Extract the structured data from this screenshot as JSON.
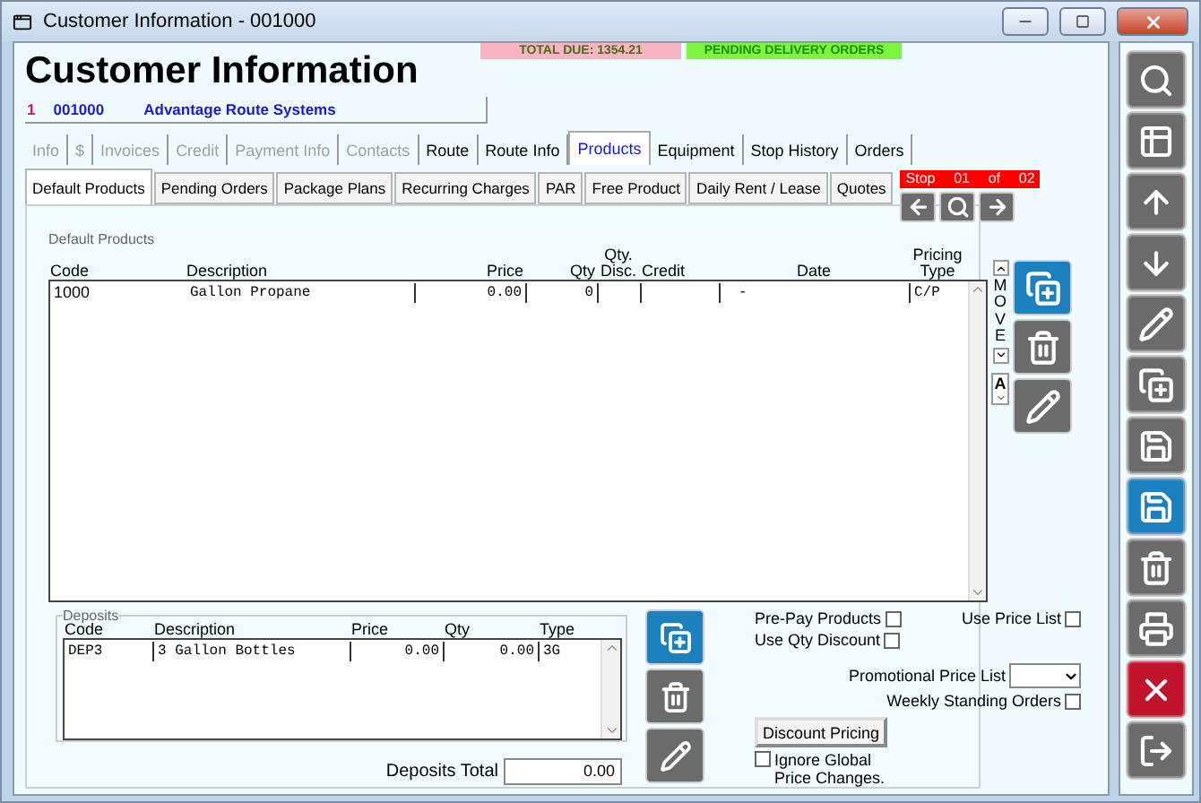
{
  "window": {
    "title": "Customer Information - 001000"
  },
  "banners": [
    {
      "kind": "due",
      "text": "TOTAL DUE:  1354.21"
    },
    {
      "kind": "pending",
      "text": "PENDING DELIVERY ORDERS"
    }
  ],
  "heading": "Customer Information",
  "customer": {
    "number": "1",
    "id": "001000",
    "name": "Advantage Route Systems"
  },
  "tabs": [
    {
      "label": "Info",
      "disabled": true,
      "selected": false
    },
    {
      "label": "$",
      "disabled": true,
      "selected": false
    },
    {
      "label": "Invoices",
      "disabled": true,
      "selected": false
    },
    {
      "label": "Credit",
      "disabled": true,
      "selected": false
    },
    {
      "label": "Payment Info",
      "disabled": true,
      "selected": false
    },
    {
      "label": "Contacts",
      "disabled": true,
      "selected": false
    },
    {
      "label": "Route",
      "disabled": false,
      "selected": false
    },
    {
      "label": "Route Info",
      "disabled": false,
      "selected": false
    },
    {
      "label": "Products",
      "disabled": false,
      "selected": true
    },
    {
      "label": "Equipment",
      "disabled": false,
      "selected": false
    },
    {
      "label": "Stop History",
      "disabled": false,
      "selected": false
    },
    {
      "label": "Orders",
      "disabled": false,
      "selected": false
    }
  ],
  "subtabs": [
    {
      "label": "Default Products",
      "selected": true
    },
    {
      "label": "Pending Orders",
      "selected": false
    },
    {
      "label": "Package Plans",
      "selected": false
    },
    {
      "label": "Recurring Charges",
      "selected": false
    },
    {
      "label": "PAR",
      "selected": false
    },
    {
      "label": "Free Product",
      "selected": false
    },
    {
      "label": "Daily Rent / Lease",
      "selected": false
    },
    {
      "label": "Quotes",
      "selected": false
    }
  ],
  "stop": {
    "label": "Stop",
    "current": "01",
    "of": "of",
    "total": "02"
  },
  "products": {
    "caption": "Default Products",
    "columns": [
      "Code",
      "Description",
      "Price",
      "Qty",
      "Qty.\nDisc.",
      "Credit",
      "Date",
      "Pricing\nType"
    ],
    "rows": [
      {
        "code": "1000",
        "description": "Gallon Propane",
        "price": "0.00",
        "qty": "0",
        "date": "-",
        "pricing_type": "C/P"
      }
    ]
  },
  "move_label": "MOVE",
  "sort_label": "A",
  "deposits": {
    "caption": "Deposits",
    "columns": [
      "Code",
      "Description",
      "Price",
      "Qty",
      "Type"
    ],
    "rows": [
      {
        "code": "DEP3",
        "description": "3 Gallon Bottles",
        "price": "0.00",
        "qty": "0.00",
        "type": "3G"
      }
    ]
  },
  "deposits_total": {
    "label": "Deposits Total",
    "value": "0.00"
  },
  "options": {
    "pre_pay": {
      "label": "Pre-Pay Products",
      "checked": false
    },
    "use_price_list": {
      "label": "Use Price List",
      "checked": false
    },
    "qty_discount": {
      "label": "Use Qty Discount",
      "checked": false
    },
    "promo_label": "Promotional Price List",
    "weekly": {
      "label": "Weekly Standing Orders",
      "checked": false
    },
    "discount_button": "Discount Pricing",
    "ignore_global": {
      "label": "Ignore Global Price Changes.",
      "checked": false
    }
  }
}
